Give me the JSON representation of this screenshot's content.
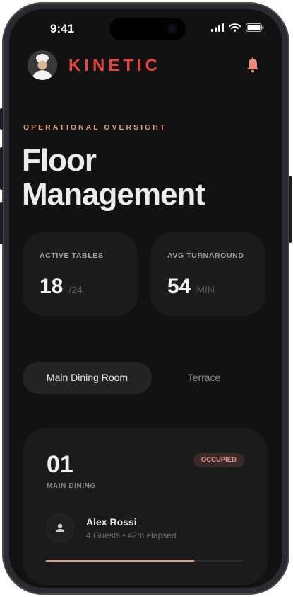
{
  "status_bar": {
    "time": "9:41"
  },
  "header": {
    "brand": "KINETIC"
  },
  "page": {
    "eyebrow": "OPERATIONAL OVERSIGHT",
    "title_line1": "Floor",
    "title_line2": "Management"
  },
  "stats": [
    {
      "label": "ACTIVE TABLES",
      "value": "18",
      "sub": "/24"
    },
    {
      "label": "AVG TURNAROUND",
      "value": "54",
      "sub": "MIN"
    }
  ],
  "tabs": [
    {
      "label": "Main Dining Room",
      "active": true
    },
    {
      "label": "Terrace",
      "active": false
    }
  ],
  "table_card": {
    "number": "01",
    "area": "MAIN DINING",
    "status": "OCCUPIED",
    "guest_name": "Alex Rossi",
    "guest_meta": "4 Guests • 42m elapsed",
    "progress": 0.75
  },
  "colors": {
    "accent": "#e5453d",
    "eyebrow": "#e9a07e",
    "progress": "#e39b86",
    "background": "#121212"
  },
  "icons": [
    "signal-icon",
    "wifi-icon",
    "battery-icon",
    "chef-avatar",
    "bell-icon",
    "person-icon"
  ]
}
